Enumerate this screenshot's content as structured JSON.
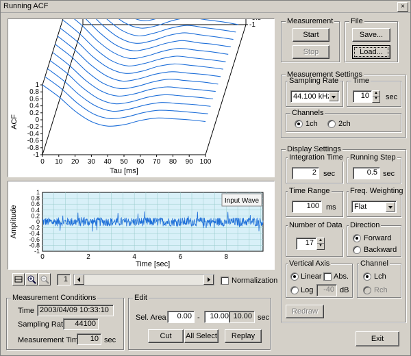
{
  "window": {
    "title": "Running ACF",
    "close_glyph": "×"
  },
  "measurement": {
    "legend": "Measurement",
    "start_label": "Start",
    "stop_label": "Stop"
  },
  "file": {
    "legend": "File",
    "save_label": "Save...",
    "load_label": "Load..."
  },
  "measurement_settings": {
    "legend": "Measurement Settings",
    "sampling_rate": {
      "legend": "Sampling Rate",
      "value": "44.100 kHz"
    },
    "time": {
      "legend": "Time",
      "value": "10",
      "unit": "sec"
    },
    "channels": {
      "legend": "Channels",
      "options": [
        "1ch",
        "2ch"
      ],
      "selected": "1ch"
    }
  },
  "display_settings": {
    "legend": "Display Settings",
    "integration_time": {
      "legend": "Integration Time",
      "value": "2",
      "unit": "sec"
    },
    "running_step": {
      "legend": "Running Step",
      "value": "0.5",
      "unit": "sec"
    },
    "time_range": {
      "legend": "Time Range",
      "value": "100",
      "unit": "ms"
    },
    "freq_weighting": {
      "legend": "Freq. Weighting",
      "value": "Flat"
    },
    "number_of_data": {
      "legend": "Number of Data",
      "value": "17"
    },
    "direction": {
      "legend": "Direction",
      "options": [
        "Forward",
        "Backward"
      ],
      "selected": "Forward"
    },
    "vertical_axis": {
      "legend": "Vertical Axis",
      "linear_label": "Linear",
      "abs_label": "Abs.",
      "log_label": "Log",
      "log_value": "-40",
      "log_unit": "dB",
      "selected": "Linear"
    },
    "channel": {
      "legend": "Channel",
      "options": [
        "Lch",
        "Rch"
      ],
      "selected": "Lch"
    },
    "redraw_label": "Redraw"
  },
  "exit_label": "Exit",
  "toolbar": {
    "page_value": "1",
    "normalization_label": "Normalization",
    "icons": [
      "fit-view-icon",
      "zoom-in-icon",
      "zoom-out-icon"
    ]
  },
  "measurement_conditions": {
    "legend": "Measurement Conditions",
    "time_label": "Time",
    "time_value": "2003/04/09 10:33:10",
    "sampling_rate_label": "Sampling Rate",
    "sampling_rate_value": "44100",
    "measurement_time_label": "Measurement Time",
    "measurement_time_value": "10",
    "measurement_time_unit": "sec"
  },
  "edit": {
    "legend": "Edit",
    "sel_area_label": "Sel. Area",
    "from": "0.00",
    "dash": "-",
    "to": "10.00",
    "length": "10.00",
    "unit": "sec",
    "cut_label": "Cut",
    "all_select_label": "All Select",
    "replay_label": "Replay"
  },
  "chart_data": [
    {
      "type": "line",
      "title": "",
      "xlabel": "Tau [ms]",
      "ylabel": "ACF",
      "x_ticks": [
        0,
        10,
        20,
        30,
        40,
        50,
        60,
        70,
        80,
        90,
        100
      ],
      "y_ticks": [
        -1,
        -0.8,
        -0.6,
        -0.4,
        -0.2,
        0,
        0.2,
        0.4,
        0.6,
        0.8,
        1
      ],
      "y_tick_labels": [
        "-1",
        "-0.8",
        "-0.6",
        "-0.4",
        "-0.2",
        "0",
        "0.2",
        "0.4",
        "0.6",
        "0.8",
        "1"
      ],
      "right_tick_labels": [
        "1",
        "0.8",
        "0.6",
        "0.4",
        "0.2",
        "0",
        "-0.2",
        "-0.4",
        "-0.6",
        "-0.8",
        "-1"
      ],
      "xlim": [
        0,
        100
      ],
      "ylim": [
        -1,
        1
      ],
      "series_count": 17,
      "x": [
        0,
        10,
        20,
        30,
        40,
        50,
        60,
        70,
        80,
        90,
        100
      ],
      "series": [
        {
          "values": [
            1,
            0.66,
            0.25,
            -0.05,
            -0.18,
            -0.14,
            -0.02,
            0.05,
            0.03,
            0.0,
            -0.05
          ]
        },
        {
          "values": [
            1,
            0.66,
            0.24,
            -0.07,
            -0.2,
            -0.15,
            -0.03,
            0.04,
            0.02,
            -0.02,
            -0.06
          ]
        },
        {
          "values": [
            1,
            0.65,
            0.23,
            -0.08,
            -0.22,
            -0.16,
            -0.04,
            0.03,
            0.0,
            -0.03,
            -0.08
          ]
        },
        {
          "values": [
            1,
            0.65,
            0.22,
            -0.1,
            -0.24,
            -0.18,
            -0.05,
            0.02,
            -0.01,
            -0.05,
            -0.1
          ]
        },
        {
          "values": [
            1,
            0.64,
            0.21,
            -0.11,
            -0.25,
            -0.19,
            -0.06,
            0.01,
            -0.03,
            -0.07,
            -0.12
          ]
        },
        {
          "values": [
            1,
            0.64,
            0.2,
            -0.13,
            -0.27,
            -0.21,
            -0.08,
            0.0,
            -0.04,
            -0.08,
            -0.14
          ]
        },
        {
          "values": [
            1,
            0.63,
            0.19,
            -0.14,
            -0.29,
            -0.22,
            -0.09,
            -0.02,
            -0.06,
            -0.1,
            -0.16
          ]
        },
        {
          "values": [
            1,
            0.63,
            0.18,
            -0.15,
            -0.3,
            -0.24,
            -0.1,
            -0.03,
            -0.07,
            -0.12,
            -0.18
          ]
        },
        {
          "values": [
            1,
            0.62,
            0.17,
            -0.17,
            -0.32,
            -0.25,
            -0.12,
            -0.04,
            -0.09,
            -0.14,
            -0.2
          ]
        },
        {
          "values": [
            1,
            0.62,
            0.16,
            -0.18,
            -0.34,
            -0.27,
            -0.13,
            -0.05,
            -0.1,
            -0.15,
            -0.22
          ]
        },
        {
          "values": [
            1,
            0.61,
            0.15,
            -0.2,
            -0.35,
            -0.28,
            -0.14,
            -0.06,
            -0.12,
            -0.17,
            -0.24
          ]
        },
        {
          "values": [
            1,
            0.61,
            0.14,
            -0.21,
            -0.37,
            -0.3,
            -0.15,
            -0.07,
            -0.13,
            -0.19,
            -0.26
          ]
        },
        {
          "values": [
            1,
            0.6,
            0.13,
            -0.23,
            -0.39,
            -0.31,
            -0.17,
            -0.09,
            -0.15,
            -0.21,
            -0.28
          ]
        },
        {
          "values": [
            1,
            0.6,
            0.12,
            -0.24,
            -0.4,
            -0.33,
            -0.18,
            -0.1,
            -0.16,
            -0.22,
            -0.3
          ]
        },
        {
          "values": [
            1,
            0.59,
            0.11,
            -0.25,
            -0.42,
            -0.34,
            -0.19,
            -0.11,
            -0.18,
            -0.24,
            -0.32
          ]
        },
        {
          "values": [
            1,
            0.59,
            0.1,
            -0.27,
            -0.44,
            -0.36,
            -0.2,
            -0.12,
            -0.19,
            -0.26,
            -0.34
          ]
        },
        {
          "values": [
            1,
            0.58,
            0.09,
            -0.28,
            -0.45,
            -0.37,
            -0.22,
            -0.13,
            -0.21,
            -0.28,
            -0.36
          ]
        }
      ],
      "line_color": "#1e6fd9",
      "grid": false,
      "projection": "3d"
    },
    {
      "type": "line",
      "title": "",
      "xlabel": "Time [sec]",
      "ylabel": "Amplitude",
      "legend_label": "Input Wave",
      "legend_position": "top-right",
      "x_ticks": [
        0,
        2,
        4,
        6,
        8
      ],
      "y_ticks": [
        -1,
        -0.8,
        -0.6,
        -0.4,
        -0.2,
        0,
        0.2,
        0.4,
        0.6,
        0.8,
        1
      ],
      "y_tick_labels": [
        "-1",
        "-0.8",
        "-0.6",
        "-0.4",
        "-0.2",
        "0",
        "0.2",
        "0.4",
        "0.6",
        "0.8",
        "1"
      ],
      "xlim": [
        0,
        9.6
      ],
      "ylim": [
        -1,
        1
      ],
      "grid": true,
      "background_color": "#d8f0f8",
      "line_color": "#1e6fd9",
      "signal": "noise-like waveform, amplitude mostly within ±0.2, peaks near ±0.35"
    }
  ]
}
